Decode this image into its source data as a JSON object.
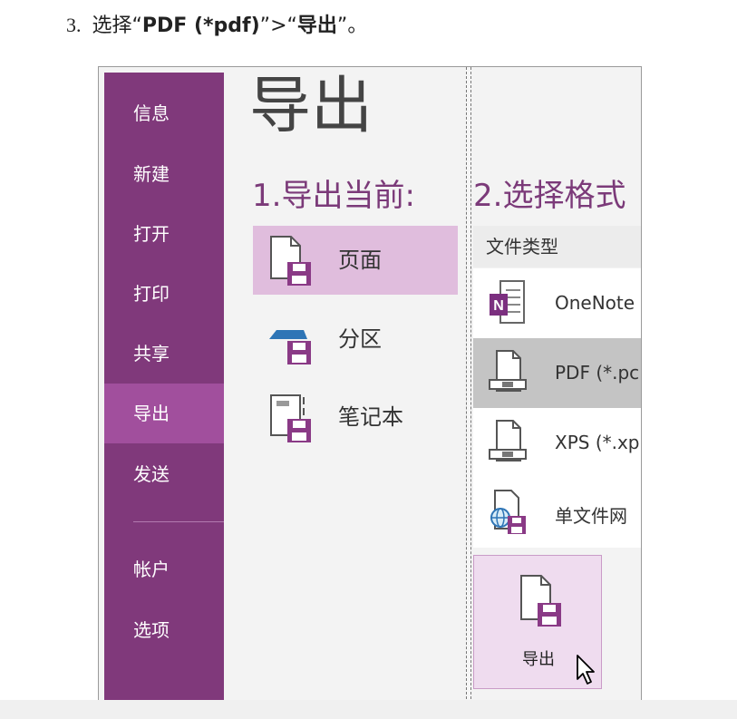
{
  "instruction": {
    "number": "3.",
    "prefix": "选择“",
    "format": "PDF (*pdf)",
    "middle": "”>“",
    "action": "导出",
    "suffix": "”。"
  },
  "sidebar": {
    "items": [
      {
        "label": "信息"
      },
      {
        "label": "新建"
      },
      {
        "label": "打开"
      },
      {
        "label": "打印"
      },
      {
        "label": "共享"
      },
      {
        "label": "导出",
        "active": true
      },
      {
        "label": "发送"
      },
      {
        "label": "帐户"
      },
      {
        "label": "选项"
      }
    ]
  },
  "main": {
    "title": "导出",
    "section_heading": "1.导出当前:",
    "options": [
      {
        "label": "页面",
        "selected": true,
        "icon": "page-export-icon"
      },
      {
        "label": "分区",
        "icon": "section-export-icon"
      },
      {
        "label": "笔记本",
        "icon": "notebook-export-icon"
      }
    ]
  },
  "format_panel": {
    "heading": "2.选择格式",
    "file_type_header": "文件类型",
    "formats": [
      {
        "label": "OneNote",
        "icon": "onenote-file-icon"
      },
      {
        "label": "PDF (*.pc",
        "selected": true,
        "icon": "pdf-file-icon"
      },
      {
        "label": "XPS (*.xp",
        "icon": "xps-file-icon"
      },
      {
        "label": "单文件网",
        "icon": "web-file-icon"
      }
    ],
    "export_button": {
      "label": "导出",
      "icon": "export-file-icon"
    }
  },
  "colors": {
    "sidebar_bg": "#80397b",
    "sidebar_active": "#a14f9d",
    "accent_text": "#7b3a79",
    "option_selected": "#e0bddd",
    "format_selected": "#c4c4c4",
    "export_button_bg": "#efdcef"
  }
}
